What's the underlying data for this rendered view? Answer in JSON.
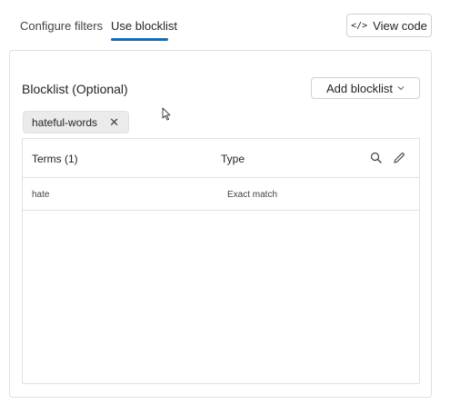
{
  "tabs": [
    {
      "label": "Configure filters",
      "selected": false
    },
    {
      "label": "Use blocklist",
      "selected": true
    }
  ],
  "view_code": {
    "icon": "code-icon",
    "icon_glyph": "</>",
    "label": "View code"
  },
  "blocklist": {
    "title": "Blocklist (Optional)",
    "add_button": {
      "label": "Add blocklist",
      "icon": "chevron-down-icon"
    },
    "selected_chip": {
      "label": "hateful-words",
      "remove_icon": "close-icon",
      "remove_glyph": "✕"
    }
  },
  "table": {
    "columns": [
      "Terms (1)",
      "Type"
    ],
    "tools": [
      "search-icon",
      "edit-icon"
    ],
    "rows": [
      {
        "term": "hate",
        "type": "Exact match"
      }
    ]
  },
  "colors": {
    "accent": "#0f6cbd",
    "border": "#e0e0e0",
    "chip_bg": "#ebebeb"
  }
}
